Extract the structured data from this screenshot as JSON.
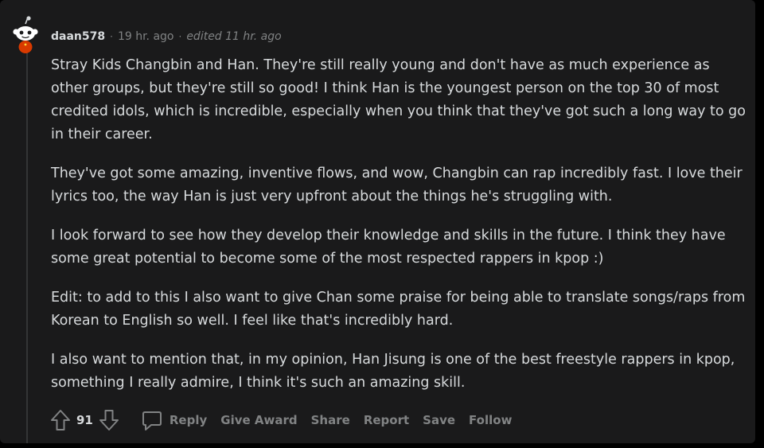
{
  "comment": {
    "author": "daan578",
    "time": "19 hr. ago",
    "edited": "edited 11 hr. ago",
    "separator": "·",
    "paragraphs": [
      "Stray Kids Changbin and Han. They're still really young and don't have as much experience as other groups, but they're still so good! I think Han is the youngest person on the top 30 of most credited idols, which is incredible, especially when you think that they've got such a long way to go in their career.",
      "They've got some amazing, inventive flows, and wow, Changbin can rap incredibly fast. I love their lyrics too, the way Han is just very upfront about the things he's struggling with.",
      "I look forward to see how they develop their knowledge and skills in the future. I think they have some great potential to become some of the most respected rappers in kpop :)",
      "Edit: to add to this I also want to give Chan some praise for being able to translate songs/raps from Korean to English so well. I feel like that's incredibly hard.",
      "I also want to mention that, in my opinion, Han Jisung is one of the best freestyle rappers in kpop, something I really admire, I think it's such an amazing skill."
    ],
    "score": "91",
    "actions": {
      "reply": "Reply",
      "give_award": "Give Award",
      "share": "Share",
      "report": "Report",
      "save": "Save",
      "follow": "Follow"
    }
  },
  "icons": {
    "avatar": "snoo-avatar-icon",
    "upvote": "upvote-arrow-icon",
    "downvote": "downvote-arrow-icon",
    "comment": "comment-bubble-icon"
  },
  "colors": {
    "background": "#1a1a1b",
    "text": "#d7dadc",
    "muted": "#818384",
    "thread_line": "#343536",
    "avatar_red": "#d93a00"
  }
}
